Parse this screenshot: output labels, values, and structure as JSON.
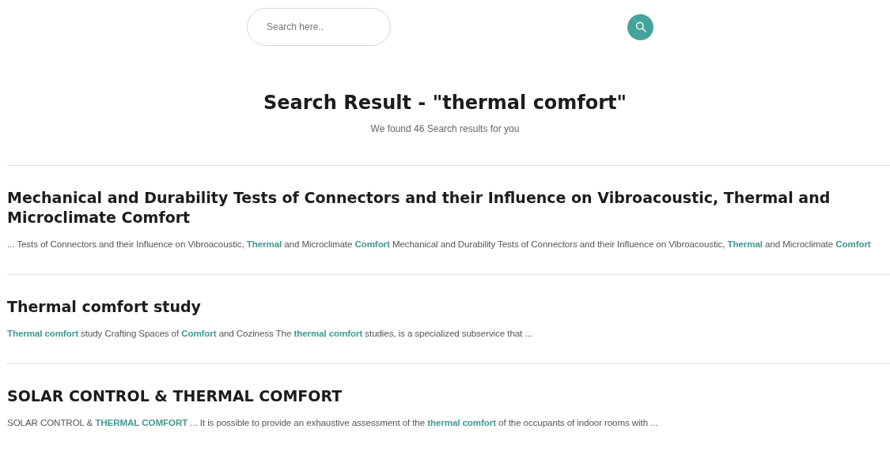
{
  "search": {
    "placeholder": "Search here.."
  },
  "heading": "Search Result - \"thermal comfort\"",
  "summary": "We found 46 Search results for you",
  "results": [
    {
      "title": "Mechanical and Durability Tests of Connectors and their Influence on Vibroacoustic, Thermal and Microclimate Comfort",
      "snippet": "... Tests of Connectors and their Influence on Vibroacoustic, **Thermal** and Microclimate **Comfort** Mechanical and Durability Tests of Connectors and their Influence on Vibroacoustic, **Thermal** and Microclimate **Comfort**"
    },
    {
      "title": "Thermal comfort study",
      "snippet": "**Thermal comfort** study Crafting Spaces of **Comfort** and Coziness The **thermal comfort** studies, is a specialized subservice that ..."
    },
    {
      "title": "SOLAR CONTROL & THERMAL COMFORT",
      "snippet": "SOLAR CONTROL & **THERMAL COMFORT** ... It is possible to provide an exhaustive assessment of the **thermal comfort** of the occupants of indoor rooms with ..."
    }
  ]
}
